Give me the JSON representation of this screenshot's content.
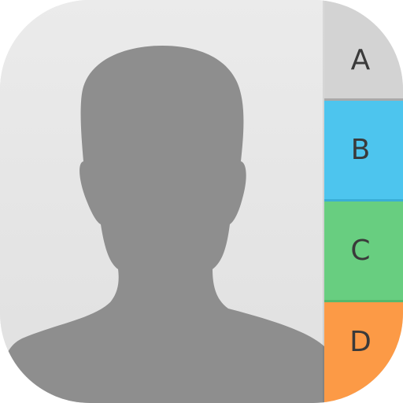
{
  "tabs": [
    {
      "letter": "A",
      "color": "#d3d3d3"
    },
    {
      "letter": "B",
      "color": "#4dc5ee"
    },
    {
      "letter": "C",
      "color": "#68ce80"
    },
    {
      "letter": "D",
      "color": "#fc9a46"
    }
  ],
  "colors": {
    "page": "#e6e6e6",
    "silhouette": "#8e8e8e"
  },
  "icons": {
    "avatar": "person-silhouette-icon"
  }
}
